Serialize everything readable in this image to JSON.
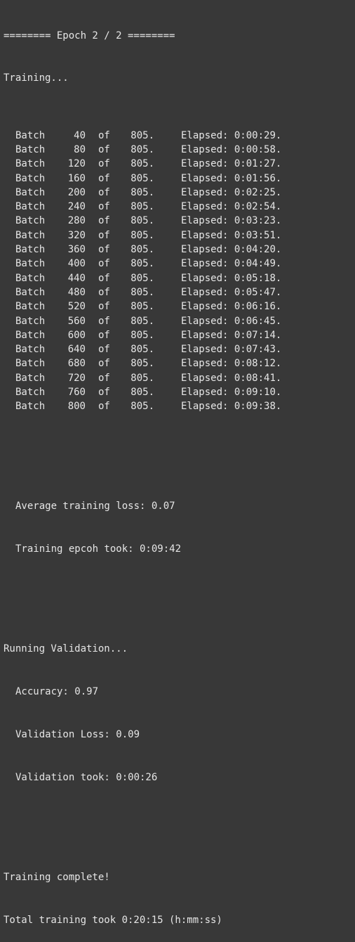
{
  "header": {
    "epoch_line": "======== Epoch 2 / 2 ========",
    "training_label": "Training..."
  },
  "batch_word": "Batch",
  "of_word": "of",
  "elapsed_word": "Elapsed:",
  "total_batches": "805.",
  "batches": [
    {
      "num": "40",
      "elapsed": "0:00:29."
    },
    {
      "num": "80",
      "elapsed": "0:00:58."
    },
    {
      "num": "120",
      "elapsed": "0:01:27."
    },
    {
      "num": "160",
      "elapsed": "0:01:56."
    },
    {
      "num": "200",
      "elapsed": "0:02:25."
    },
    {
      "num": "240",
      "elapsed": "0:02:54."
    },
    {
      "num": "280",
      "elapsed": "0:03:23."
    },
    {
      "num": "320",
      "elapsed": "0:03:51."
    },
    {
      "num": "360",
      "elapsed": "0:04:20."
    },
    {
      "num": "400",
      "elapsed": "0:04:49."
    },
    {
      "num": "440",
      "elapsed": "0:05:18."
    },
    {
      "num": "480",
      "elapsed": "0:05:47."
    },
    {
      "num": "520",
      "elapsed": "0:06:16."
    },
    {
      "num": "560",
      "elapsed": "0:06:45."
    },
    {
      "num": "600",
      "elapsed": "0:07:14."
    },
    {
      "num": "640",
      "elapsed": "0:07:43."
    },
    {
      "num": "680",
      "elapsed": "0:08:12."
    },
    {
      "num": "720",
      "elapsed": "0:08:41."
    },
    {
      "num": "760",
      "elapsed": "0:09:10."
    },
    {
      "num": "800",
      "elapsed": "0:09:38."
    }
  ],
  "training_summary": {
    "avg_loss": "Average training loss: 0.07",
    "epoch_time": "Training epcoh took: 0:09:42"
  },
  "validation": {
    "header": "Running Validation...",
    "accuracy": "Accuracy: 0.97",
    "loss": "Validation Loss: 0.09",
    "time": "Validation took: 0:00:26"
  },
  "final": {
    "complete": "Training complete!",
    "total": "Total training took 0:20:15 (h:mm:ss)"
  },
  "colors": {
    "background": "#383838",
    "text": "#e6e6e6"
  }
}
